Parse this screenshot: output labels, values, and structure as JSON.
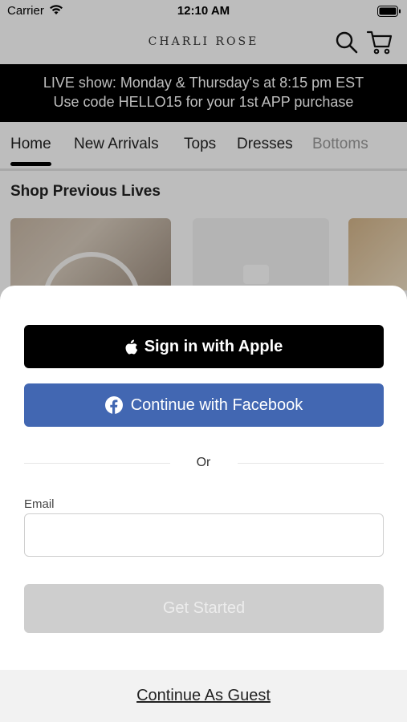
{
  "status_bar": {
    "carrier": "Carrier",
    "time": "12:10 AM"
  },
  "header": {
    "brand": "CHARLI ROSE"
  },
  "promo": {
    "line1": "LIVE show: Monday & Thursday's at 8:15 pm EST",
    "line2": "Use code HELLO15 for your 1st APP purchase"
  },
  "tabs": [
    {
      "label": "Home",
      "active": true
    },
    {
      "label": "New Arrivals"
    },
    {
      "label": "Tops"
    },
    {
      "label": "Dresses"
    },
    {
      "label": "Bottoms"
    }
  ],
  "section": {
    "title": "Shop Previous Lives"
  },
  "sheet": {
    "apple_label": "Sign in with Apple",
    "facebook_label": "Continue with Facebook",
    "or_label": "Or",
    "email_label": "Email",
    "email_value": "",
    "get_started_label": "Get Started",
    "guest_label": "Continue As Guest"
  },
  "colors": {
    "promo_bg": "#000000",
    "apple_bg": "#000000",
    "facebook_bg": "#4267B2",
    "get_started_disabled_bg": "#CECECE",
    "overlay": "rgba(0,0,0,0.26)"
  },
  "icons": [
    "wifi-icon",
    "battery-icon",
    "search-icon",
    "cart-icon",
    "apple-icon",
    "facebook-icon",
    "play-icon"
  ]
}
